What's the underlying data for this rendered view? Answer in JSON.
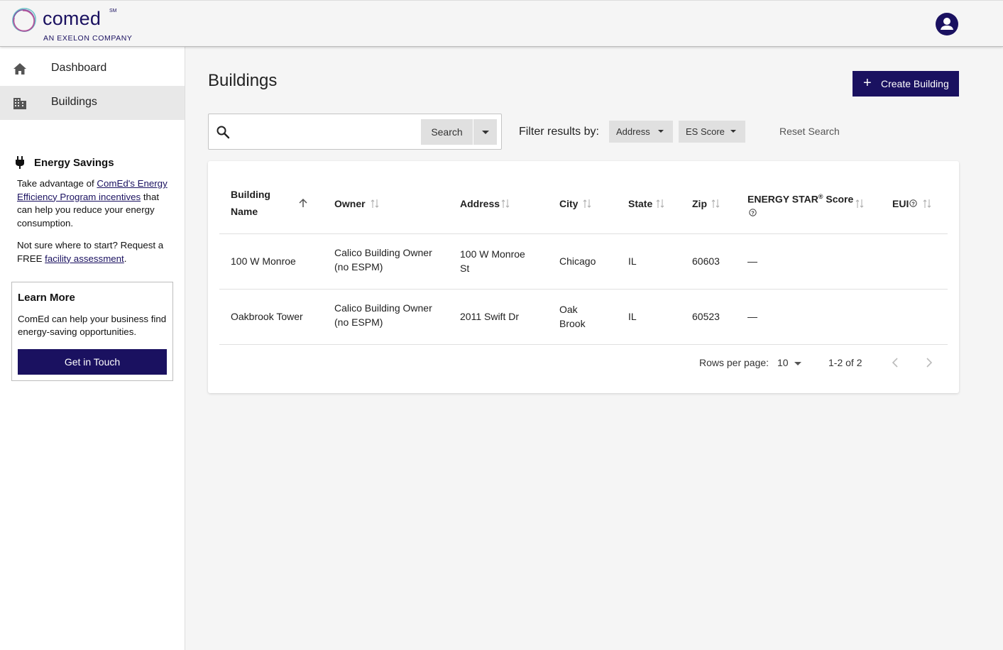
{
  "brand": {
    "name": "comed",
    "mark": "SM",
    "tagline": "AN EXELON COMPANY",
    "primary_color": "#1a1160"
  },
  "header": {
    "avatar_icon": "account-circle-icon"
  },
  "sidebar": {
    "items": [
      {
        "label": "Dashboard",
        "icon": "home-icon",
        "active": false
      },
      {
        "label": "Buildings",
        "icon": "building-icon",
        "active": true
      }
    ],
    "energy_savings": {
      "title": "Energy Savings",
      "p1_a": "Take advantage of ",
      "p1_link": "ComEd's Energy Efficiency Program incentives",
      "p1_b": " that can help you reduce your energy consumption.",
      "p2_a": "Not sure where to start? Request a FREE ",
      "p2_link": "facility assessment",
      "p2_b": "."
    },
    "learn_more": {
      "title": "Learn More",
      "text": "ComEd can help your business find energy-saving opportunities.",
      "button": "Get in Touch"
    }
  },
  "main": {
    "title": "Buildings",
    "create_button": "Create Building",
    "search": {
      "placeholder": "",
      "value": "",
      "button": "Search"
    },
    "filter_label": "Filter results by:",
    "filters": [
      "Address",
      "ES Score"
    ],
    "reset": "Reset Search"
  },
  "table": {
    "columns": [
      {
        "line1": "Building",
        "line2": "Name"
      },
      {
        "label": "Owner"
      },
      {
        "label": "Address"
      },
      {
        "label": "City"
      },
      {
        "label": "State"
      },
      {
        "label": "Zip"
      },
      {
        "line1": "ENERGY STAR",
        "sup": "®",
        "line1b": " Score"
      },
      {
        "label": "EUI"
      }
    ],
    "rows": [
      {
        "name": "100 W Monroe",
        "owner_1": "Calico Building Owner",
        "owner_2": "(no ESPM)",
        "address_1": "100 W Monroe",
        "address_2": "St",
        "city_1": "Chicago",
        "city_2": "",
        "state": "IL",
        "zip": "60603",
        "es_score": "—",
        "eui": ""
      },
      {
        "name": "Oakbrook Tower",
        "owner_1": "Calico Building Owner",
        "owner_2": "(no ESPM)",
        "address_1": "2011 Swift Dr",
        "address_2": "",
        "city_1": "Oak",
        "city_2": "Brook",
        "state": "IL",
        "zip": "60523",
        "es_score": "—",
        "eui": ""
      }
    ],
    "pagination": {
      "rows_label": "Rows per page:",
      "rows_value": "10",
      "range": "1-2 of 2"
    }
  }
}
